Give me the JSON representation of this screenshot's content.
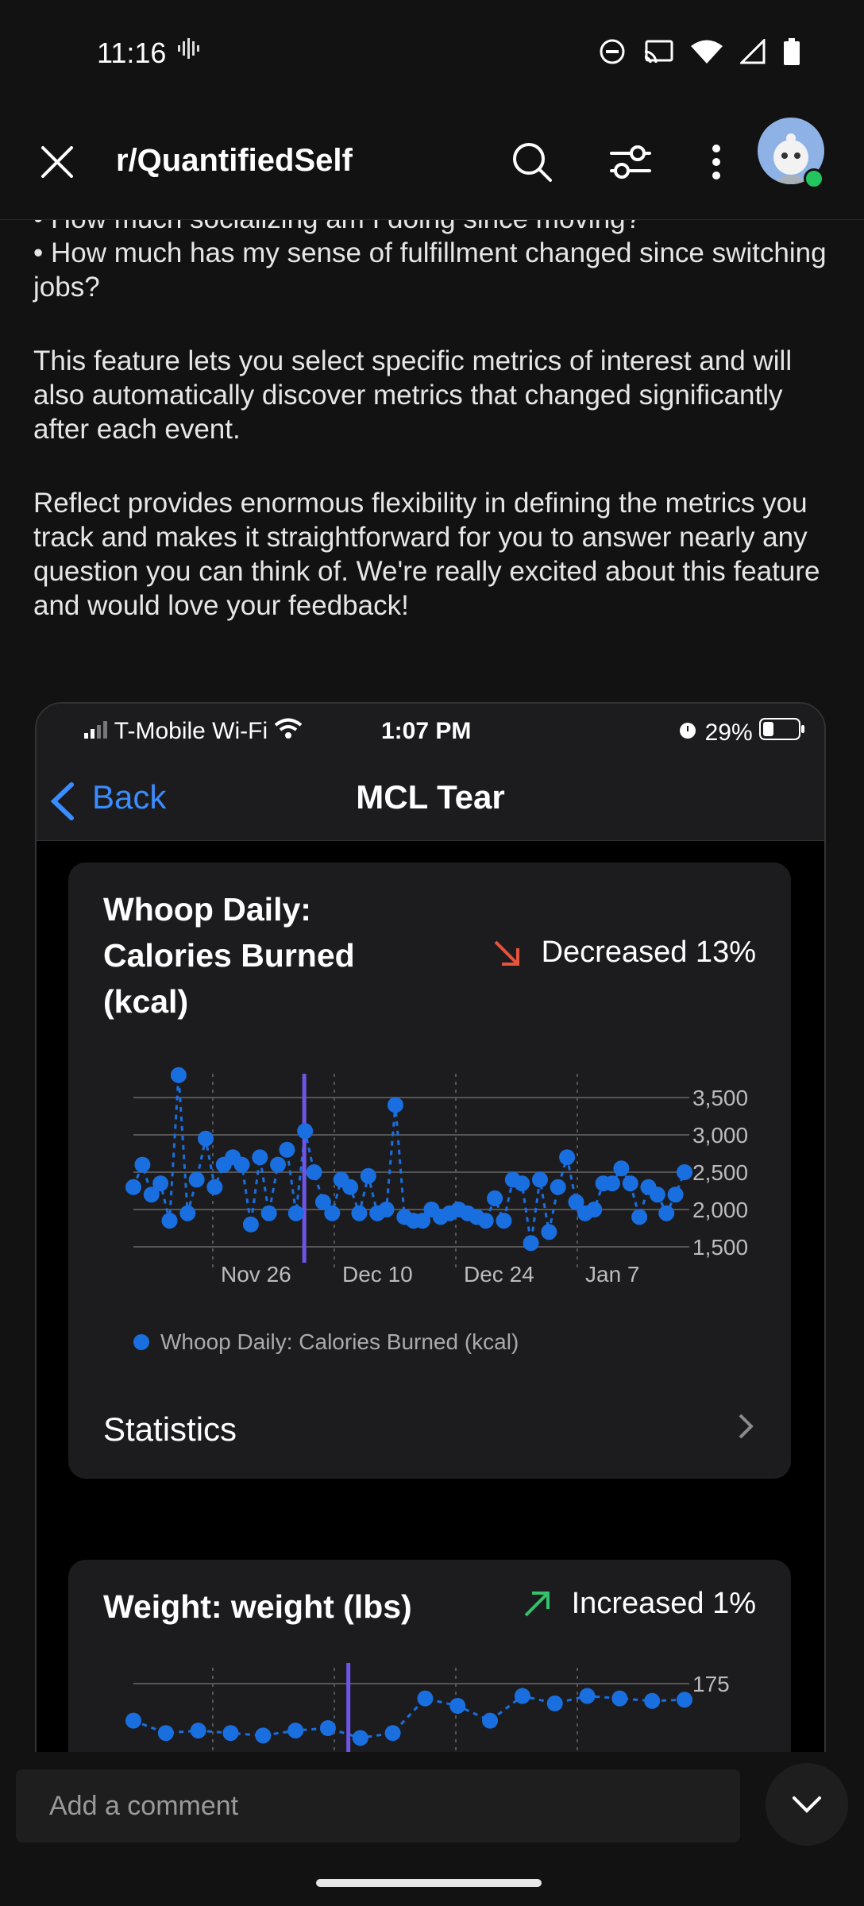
{
  "status_bar": {
    "time": "11:16"
  },
  "app_bar": {
    "subreddit": "r/QuantifiedSelf"
  },
  "post": {
    "bullets": [
      "• How much socializing am I doing since moving?",
      "• How much has my sense of fulfillment changed since switching jobs?"
    ],
    "para1": "This feature lets you select specific metrics of interest and will also automatically discover metrics that changed significantly after each event.",
    "para2": "Reflect provides enormous flexibility in defining the metrics you track and makes it straightforward for you to answer nearly any question you can think of. We're really excited about this feature and would love your feedback!"
  },
  "embedded": {
    "carrier": "T-Mobile Wi-Fi",
    "clock": "1:07 PM",
    "battery": "29%",
    "back_label": "Back",
    "title": "MCL Tear",
    "card1": {
      "title": "Whoop Daily: Calories Burned (kcal)",
      "change": "Decreased 13%",
      "change_color": "#e5533d",
      "legend": "Whoop Daily: Calories Burned (kcal)",
      "statistics_label": "Statistics"
    },
    "card2": {
      "title": "Weight: weight (lbs)",
      "change": "Increased 1%",
      "change_color": "#33c26b"
    }
  },
  "chart_data": [
    {
      "type": "scatter",
      "title": "Whoop Daily: Calories Burned (kcal)",
      "x_ticks": [
        "Nov 26",
        "Dec 10",
        "Dec 24",
        "Jan 7"
      ],
      "y_ticks": [
        3500,
        3000,
        2500,
        2000,
        1500
      ],
      "ylim": [
        1500,
        3500
      ],
      "event_marker": "Dec 12",
      "series": [
        {
          "name": "Whoop Daily: Calories Burned (kcal)",
          "color": "#1a6fe0",
          "values": [
            2300,
            2600,
            2200,
            2350,
            1850,
            3800,
            1950,
            2400,
            2950,
            2300,
            2600,
            2700,
            2600,
            1800,
            2700,
            1950,
            2600,
            2800,
            1950,
            3050,
            2500,
            2100,
            1950,
            2400,
            2300,
            1950,
            2450,
            1950,
            2000,
            3400,
            1900,
            1850,
            1850,
            2000,
            1900,
            1950,
            2000,
            1950,
            1900,
            1850,
            2150,
            1850,
            2400,
            2350,
            1550,
            2400,
            1700,
            2300,
            2700,
            2100,
            1950,
            2000,
            2350,
            2350,
            2550,
            2350,
            1900,
            2300,
            2200,
            1950,
            2200,
            2500
          ]
        }
      ]
    },
    {
      "type": "scatter",
      "title": "Weight: weight (lbs)",
      "y_ticks": [
        175
      ],
      "event_marker": "Dec 12",
      "series": [
        {
          "name": "Weight: weight (lbs)",
          "color": "#1a6fe0",
          "values": [
            173,
            172,
            172.2,
            172,
            171.8,
            172.2,
            172.4,
            171.6,
            172,
            174.8,
            174.2,
            173,
            175,
            174.4,
            175,
            174.8,
            174.6,
            174.7
          ]
        }
      ]
    }
  ]
}
